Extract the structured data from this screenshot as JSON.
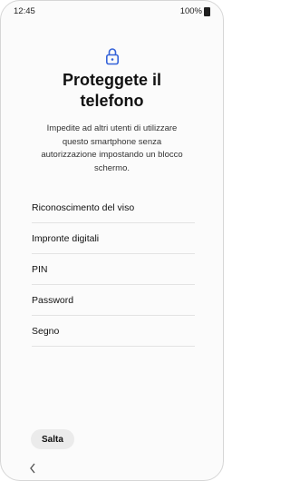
{
  "status_bar": {
    "time": "12:45",
    "battery": "100%"
  },
  "header": {
    "lock_icon": "lock-icon",
    "title": "Proteggete il\ntelefono",
    "description": "Impedite ad altri utenti di utilizzare questo smartphone senza autorizzazione impostando un blocco schermo."
  },
  "options": [
    {
      "label": "Riconoscimento del viso"
    },
    {
      "label": "Impronte digitali"
    },
    {
      "label": "PIN"
    },
    {
      "label": "Password"
    },
    {
      "label": "Segno"
    }
  ],
  "footer": {
    "skip_label": "Salta",
    "back_icon": "chevron-left-icon"
  },
  "colors": {
    "accent": "#3563d9",
    "background": "#fbfbfb",
    "divider": "#e3e3e3",
    "button_bg": "#ebebeb"
  }
}
